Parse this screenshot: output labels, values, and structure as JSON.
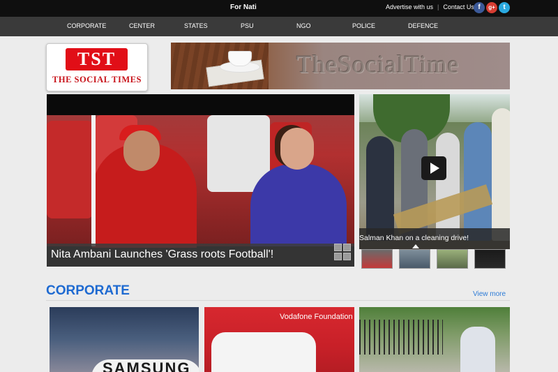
{
  "topbar": {
    "ticker": "For Nati",
    "links": [
      "Advertise with us",
      "Contact Us"
    ],
    "social": [
      {
        "name": "facebook-icon",
        "glyph": "f"
      },
      {
        "name": "google-plus-icon",
        "glyph": "g+"
      },
      {
        "name": "twitter-icon",
        "glyph": "t"
      }
    ]
  },
  "nav": [
    "CORPORATE",
    "CENTER",
    "STATES",
    "PSU",
    "NGO",
    "POLICE",
    "DEFENCE"
  ],
  "logo": {
    "abbr": "TST",
    "name": "THE SOCIAL TIMES"
  },
  "banner": {
    "text": "TheSocialTime"
  },
  "main_slider": {
    "caption": "Nita Ambani Launches 'Grass roots Football'!"
  },
  "side_slider": {
    "caption": "Salman Khan on a cleaning drive!"
  },
  "corporate": {
    "title": "CORPORATE",
    "view_more": "View more"
  },
  "cards": {
    "samsung": "SAMSUNG",
    "vodafone": "Vodafone Foundation"
  },
  "colors": {
    "accent_blue": "#1e6ad1",
    "logo_red": "#e10e17",
    "nav_bg": "#3a3a3a"
  }
}
